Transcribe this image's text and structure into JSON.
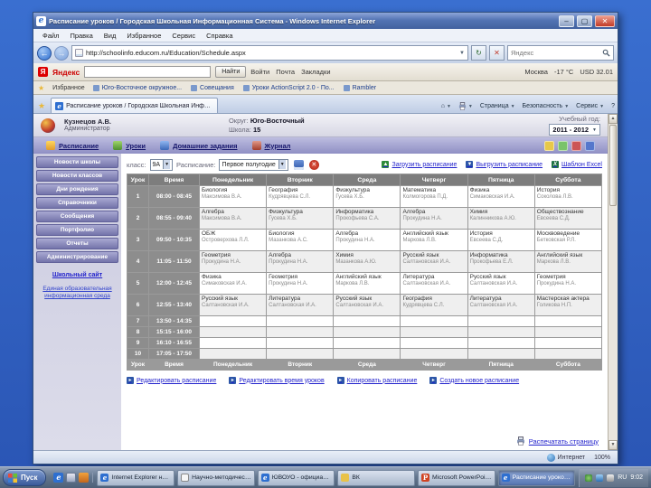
{
  "window": {
    "title": "Расписание уроков / Городская Школьная Информационная Система - Windows Internet Explorer",
    "menu_items": [
      "Файл",
      "Правка",
      "Вид",
      "Избранное",
      "Сервис",
      "Справка"
    ],
    "address": {
      "url": "http://schoolinfo.educom.ru/Education/Schedule.aspx",
      "search_value": "Яндекс"
    },
    "yandex_bar": {
      "logo": "Яндекс",
      "find_button": "Найти",
      "items": [
        "Войти",
        "Почта",
        "Закладки"
      ],
      "info": [
        "Москва",
        "-17 °C",
        "USD 32.01"
      ]
    },
    "links_bar": {
      "favorites_label": "Избранное",
      "links": [
        "Юго-Восточное окружное...",
        "Совещания",
        "Уроки ActionScript 2.0 - По...",
        "Rambler"
      ]
    },
    "tab_bar": {
      "tab_title": "Расписание уроков / Городская Школьная Информа...",
      "commands": [
        "Страница",
        "Безопасность",
        "Сервис"
      ]
    },
    "status_bar": {
      "zone": "Интернет",
      "zoom": "100%"
    }
  },
  "page": {
    "header": {
      "user_name": "Кузнецов А.В.",
      "user_role": "Администратор",
      "district_label": "Округ:",
      "district_value": "Юго-Восточный",
      "school_label": "Школа:",
      "school_value": "15",
      "year_label": "Учебный год:",
      "year_value": "2011 - 2012"
    },
    "nav_tabs": [
      {
        "id": "schedule",
        "label": "Расписание"
      },
      {
        "id": "lessons",
        "label": "Уроки"
      },
      {
        "id": "homework",
        "label": "Домашние задания"
      },
      {
        "id": "journal",
        "label": "Журнал"
      }
    ],
    "sidebar": {
      "buttons": [
        "Новости школы",
        "Новости классов",
        "Дни рождения",
        "Справочники",
        "Сообщения",
        "Портфолио",
        "Отчеты",
        "Администрирование"
      ],
      "site_link": "Школьный сайт",
      "eis_link": "Единая образовательная информационная среда"
    },
    "controls": {
      "class_label": "класс:",
      "class_value": "9А",
      "schedule_label": "Расписание:",
      "schedule_value": "Первое полугодие",
      "import_link": "Загрузить расписание",
      "export_link": "Выгрузить расписание",
      "excel_link": "Шаблон Excel"
    },
    "schedule": {
      "headers": [
        "Урок",
        "Время",
        "Понедельник",
        "Вторник",
        "Среда",
        "Четверг",
        "Пятница",
        "Суббота"
      ],
      "rows": [
        {
          "n": "1",
          "time": "08:00 - 08:45",
          "cells": [
            [
              "Биология",
              "Максимова В.А."
            ],
            [
              "География",
              "Кудрявцева С.Л."
            ],
            [
              "Физкультура",
              "Гусева Х.Б."
            ],
            [
              "Математика",
              "Колмогорова П.Д."
            ],
            [
              "Физика",
              "Симаковская И.А."
            ],
            [
              "История",
              "Соколова Л.В."
            ]
          ]
        },
        {
          "n": "2",
          "time": "08:55 - 09:40",
          "cells": [
            [
              "Алгебра",
              "Максимова В.А."
            ],
            [
              "Физкультура",
              "Гусева Х.Б."
            ],
            [
              "Информатика",
              "Прокофьева С.А."
            ],
            [
              "Алгебра",
              "Прокудина Н.А."
            ],
            [
              "Химия",
              "Калинникова А.Ю."
            ],
            [
              "Обществознание",
              "Евсеева С.Д."
            ]
          ]
        },
        {
          "n": "3",
          "time": "09:50 - 10:35",
          "cells": [
            [
              "ОБЖ",
              "Островерхова Л.Л."
            ],
            [
              "Биология",
              "Мазанкова А.С."
            ],
            [
              "Алгебра",
              "Прокудина Н.А."
            ],
            [
              "Английский язык",
              "Маркова Л.В."
            ],
            [
              "История",
              "Евсеева С.Д."
            ],
            [
              "Москвоведение",
              "Бетковская Р.Л."
            ]
          ]
        },
        {
          "n": "4",
          "time": "11:05 - 11:50",
          "cells": [
            [
              "Геометрия",
              "Прокудина Н.А."
            ],
            [
              "Алгебра",
              "Прокудина Н.А."
            ],
            [
              "Химия",
              "Мазанкова А.Ю."
            ],
            [
              "Русский язык",
              "Салтановская И.А."
            ],
            [
              "Информатика",
              "Прокофьева Е.Л."
            ],
            [
              "Английский язык",
              "Маркова Л.В."
            ]
          ]
        },
        {
          "n": "5",
          "time": "12:00 - 12:45",
          "cells": [
            [
              "Физика",
              "Симаковская И.А."
            ],
            [
              "Геометрия",
              "Прокудина Н.А."
            ],
            [
              "Английский язык",
              "Маркова Л.В."
            ],
            [
              "Литература",
              "Салтановская И.А."
            ],
            [
              "Русский язык",
              "Салтановская И.А."
            ],
            [
              "Геометрия",
              "Прокудина Н.А."
            ]
          ]
        },
        {
          "n": "6",
          "time": "12:55 - 13:40",
          "cells": [
            [
              "Русский язык",
              "Салтановская И.А."
            ],
            [
              "Литература",
              "Салтановская И.А."
            ],
            [
              "Русский язык",
              "Салтановская И.А."
            ],
            [
              "География",
              "Кудрявцева С.Л."
            ],
            [
              "Литература",
              "Салтановская И.А."
            ],
            [
              "Мастерская актера",
              "Голикова Н.П."
            ]
          ]
        },
        {
          "n": "7",
          "time": "13:50 - 14:35",
          "cells": [
            null,
            null,
            null,
            null,
            null,
            null
          ]
        },
        {
          "n": "8",
          "time": "15:15 - 16:00",
          "cells": [
            null,
            null,
            null,
            null,
            null,
            null
          ]
        },
        {
          "n": "9",
          "time": "16:10 - 16:55",
          "cells": [
            null,
            null,
            null,
            null,
            null,
            null
          ]
        },
        {
          "n": "10",
          "time": "17:05 - 17:50",
          "cells": [
            null,
            null,
            null,
            null,
            null,
            null
          ]
        }
      ]
    },
    "actions": [
      "Редактировать расписание",
      "Редактировать время уроков",
      "Копировать расписание",
      "Создать новое расписание"
    ],
    "print_link": "Распечатать страницу"
  },
  "taskbar": {
    "start_label": "Пуск",
    "tasks": [
      {
        "icon": "ie",
        "label": "Internet Explorer не м...",
        "active": false
      },
      {
        "icon": "doc",
        "label": "Научно-методический...",
        "active": false
      },
      {
        "icon": "ie",
        "label": "ЮВОУО - официальны...",
        "active": false
      },
      {
        "icon": "folder",
        "label": "ВК",
        "active": false
      },
      {
        "icon": "ppt",
        "label": "Microsoft PowerPoint...",
        "active": false
      },
      {
        "icon": "ie",
        "label": "Расписание уроков / ...",
        "active": true
      }
    ],
    "tray": {
      "lang": "RU",
      "time": "9:02"
    }
  }
}
